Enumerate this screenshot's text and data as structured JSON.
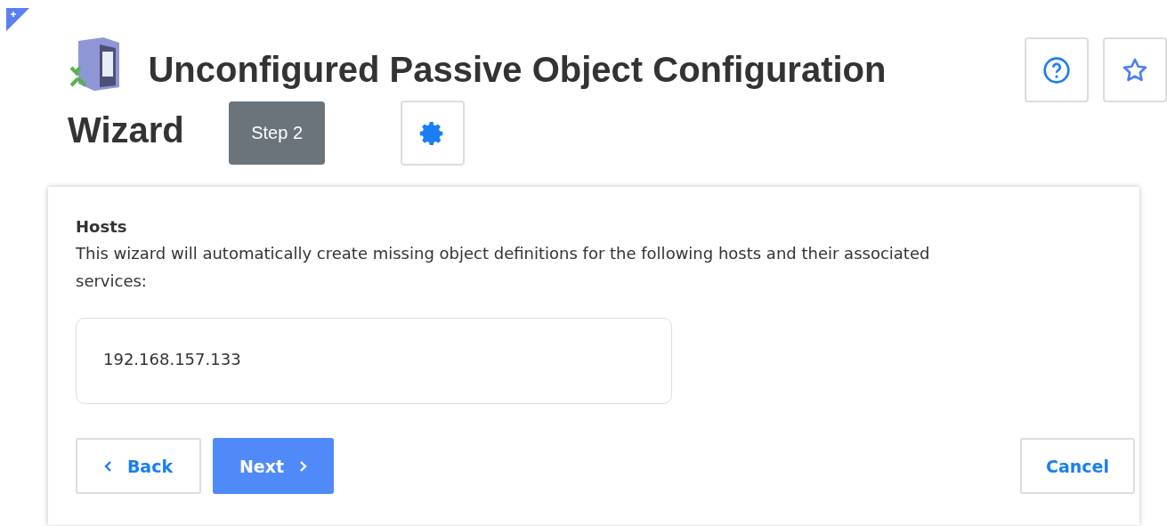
{
  "header": {
    "title_lines": [
      "Unconfigured Passive Object Configuration",
      "Wizard"
    ],
    "step": "Step 2"
  },
  "section": {
    "title": "Hosts",
    "description": "This wizard will automatically create missing object definitions for the following hosts and their associated services:",
    "hosts": "192.168.157.133"
  },
  "buttons": [
    {
      "label": "Back",
      "kind": "back"
    },
    {
      "label": "Next",
      "kind": "next"
    },
    {
      "label": "Cancel",
      "kind": "cancel"
    }
  ]
}
